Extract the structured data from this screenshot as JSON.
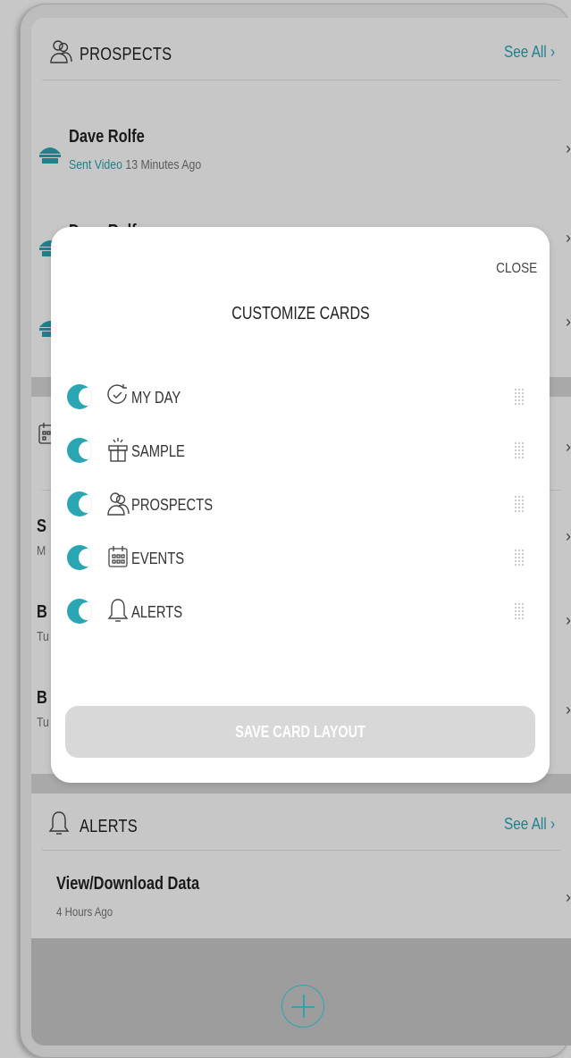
{
  "prospects_card": {
    "title": "PROSPECTS",
    "see_all": "See All",
    "rows": [
      {
        "name": "Dave Rolfe",
        "action": "Sent Video",
        "time": "13 Minutes Ago"
      },
      {
        "name": "Dave Rolfe"
      }
    ]
  },
  "events_card": {
    "rows": [
      {
        "name": "S",
        "sub": "M"
      },
      {
        "name": "B",
        "sub": "Tu"
      },
      {
        "name": "B",
        "sub": "Tu"
      }
    ]
  },
  "alerts_card": {
    "title": "ALERTS",
    "see_all": "See All",
    "rows": [
      {
        "name": "View/Download Data",
        "time": "4 Hours Ago"
      }
    ]
  },
  "modal": {
    "close": "CLOSE",
    "title": "CUSTOMIZE CARDS",
    "items": [
      {
        "label": "MY DAY",
        "icon": "clock-check-icon",
        "enabled": true
      },
      {
        "label": "SAMPLE",
        "icon": "gift-icon",
        "enabled": true
      },
      {
        "label": "PROSPECTS",
        "icon": "people-icon",
        "enabled": true
      },
      {
        "label": "EVENTS",
        "icon": "calendar-icon",
        "enabled": true
      },
      {
        "label": "ALERTS",
        "icon": "bell-icon",
        "enabled": true
      }
    ],
    "save_label": "SAVE CARD LAYOUT"
  },
  "chevron": "›",
  "colors": {
    "accent": "#2aa6b3",
    "button_disabled": "#d8d8d8",
    "overlay": "rgba(0,0,0,0.22)"
  }
}
